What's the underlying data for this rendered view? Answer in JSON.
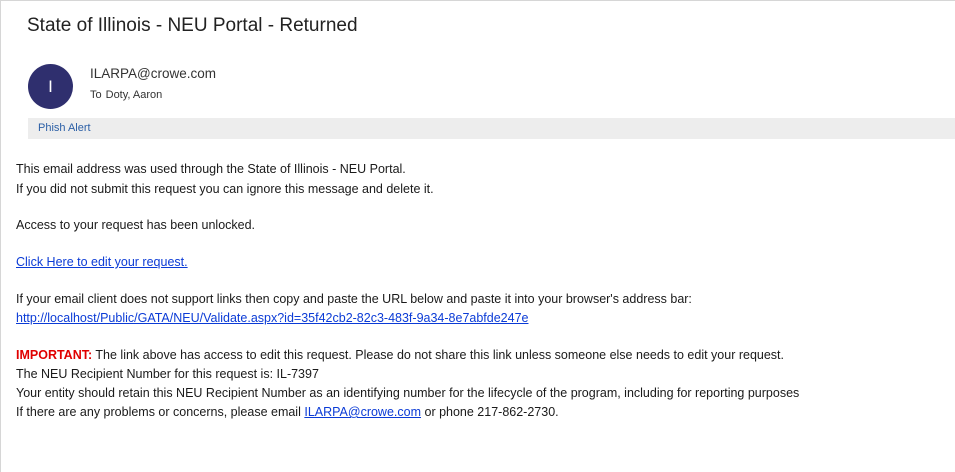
{
  "email": {
    "subject": "State of Illinois - NEU Portal - Returned",
    "sender": {
      "avatar_initial": "I",
      "address": "ILARPA@crowe.com"
    },
    "to_label": "To",
    "recipient": "Doty, Aaron",
    "phish_alert": "Phish Alert"
  },
  "body": {
    "line1": "This email address was used through the State of Illinois - NEU Portal.",
    "line2": "If you did not submit this request you can ignore this message and delete it.",
    "line3": "Access to your request has been unlocked.",
    "edit_link": "Click Here to edit your request.",
    "line4": "If your email client does not support links then copy and paste the URL below and paste it into your browser's address bar:",
    "url_link": "http://localhost/Public/GATA/NEU/Validate.aspx?id=35f42cb2-82c3-483f-9a34-8e7abfde247e",
    "important_label": "IMPORTANT:",
    "important_text": " The link above has access to edit this request. Please do not share this link unless someone else needs to edit your request.",
    "recipient_number_line": "The NEU Recipient Number for this request is: IL-7397",
    "retain_line": "Your entity should retain this NEU Recipient Number as an identifying number for the lifecycle of the program, including for reporting purposes",
    "contact_prefix": "If there are any problems or concerns, please email ",
    "contact_email": "ILARPA@crowe.com",
    "contact_suffix": " or phone 217-862-2730."
  },
  "colors": {
    "avatar_bg": "#2f2f6e",
    "link": "#0b3bd6",
    "important": "#e00000",
    "phish_bar_bg": "#ededed",
    "phish_link": "#2b5fa6"
  }
}
